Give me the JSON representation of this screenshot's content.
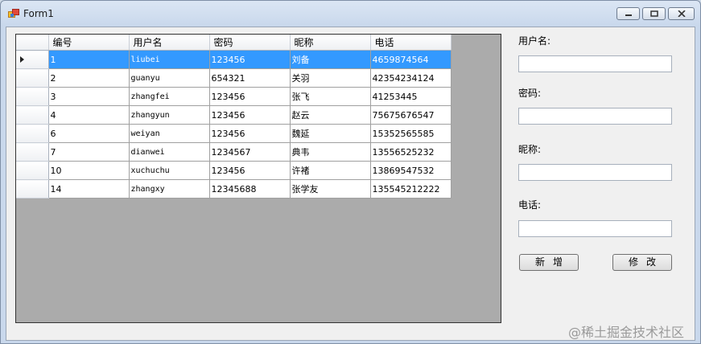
{
  "window": {
    "title": "Form1"
  },
  "grid": {
    "columns": [
      "编号",
      "用户名",
      "密码",
      "昵称",
      "电话"
    ],
    "selected_row": 0,
    "rows": [
      [
        "1",
        "liubei",
        "123456",
        "刘备",
        "4659874564"
      ],
      [
        "2",
        "guanyu",
        "654321",
        "关羽",
        "42354234124"
      ],
      [
        "3",
        "zhangfei",
        "123456",
        "张飞",
        "41253445"
      ],
      [
        "4",
        "zhangyun",
        "123456",
        "赵云",
        "75675676547"
      ],
      [
        "6",
        "weiyan",
        "123456",
        "魏延",
        "15352565585"
      ],
      [
        "7",
        "dianwei",
        "1234567",
        "典韦",
        "13556525232"
      ],
      [
        "10",
        "xuchuchu",
        "123456",
        "许褚",
        "13869547532"
      ],
      [
        "14",
        "zhangxy",
        "12345688",
        "张学友",
        "135545212222"
      ]
    ]
  },
  "form": {
    "username_label": "用户名:",
    "username_value": "",
    "password_label": "密码:",
    "password_value": "",
    "nickname_label": "昵称:",
    "nickname_value": "",
    "phone_label": "电话:",
    "phone_value": "",
    "add_button": "新增",
    "edit_button": "修改"
  },
  "watermark": "@稀土掘金技术社区",
  "colors": {
    "selection": "#3399ff",
    "grid_background": "#ababab",
    "form_background": "#f0f0f0"
  }
}
